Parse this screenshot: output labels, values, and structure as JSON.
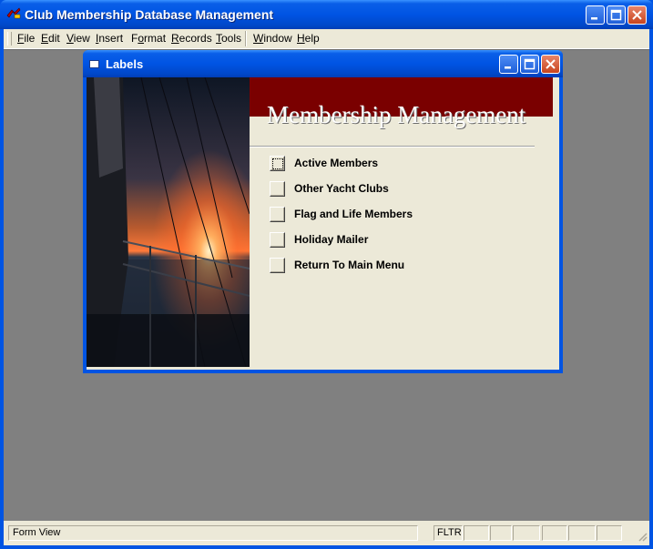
{
  "app": {
    "title": "Club Membership Database Management",
    "menu": [
      "File",
      "Edit",
      "View",
      "Insert",
      "Format",
      "Records",
      "Tools",
      "Window",
      "Help"
    ],
    "menu_hotkeys": [
      "F",
      "E",
      "V",
      "I",
      "o",
      "R",
      "T",
      "W",
      "H"
    ]
  },
  "child": {
    "title": "Labels",
    "heading": "Membership Management",
    "options": [
      {
        "label": "Active Members",
        "focused": true
      },
      {
        "label": "Other Yacht Clubs",
        "focused": false
      },
      {
        "label": "Flag and Life Members",
        "focused": false
      },
      {
        "label": "Holiday Mailer",
        "focused": false
      },
      {
        "label": "Return To Main Menu",
        "focused": false
      }
    ]
  },
  "status": {
    "mode": "Form View",
    "filter": "FLTR"
  },
  "colors": {
    "title_blue": "#0054e3",
    "banner_red": "#7a0000",
    "mdi_gray": "#808080",
    "face": "#ece9d8"
  }
}
